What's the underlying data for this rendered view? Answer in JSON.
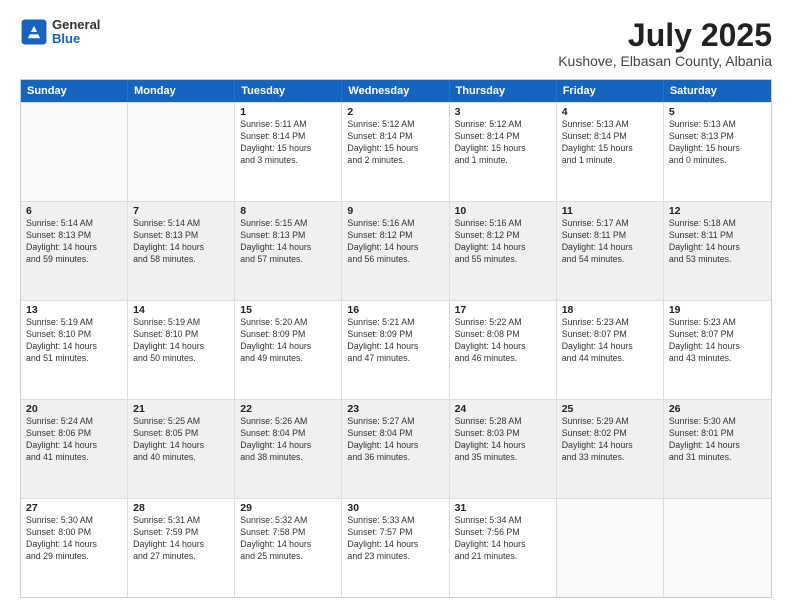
{
  "header": {
    "logo_general": "General",
    "logo_blue": "Blue",
    "main_title": "July 2025",
    "subtitle": "Kushove, Elbasan County, Albania"
  },
  "days_of_week": [
    "Sunday",
    "Monday",
    "Tuesday",
    "Wednesday",
    "Thursday",
    "Friday",
    "Saturday"
  ],
  "rows": [
    [
      {
        "day": "",
        "info": "",
        "shaded": false,
        "empty": true
      },
      {
        "day": "",
        "info": "",
        "shaded": false,
        "empty": true
      },
      {
        "day": "1",
        "info": "Sunrise: 5:11 AM\nSunset: 8:14 PM\nDaylight: 15 hours\nand 3 minutes.",
        "shaded": false,
        "empty": false
      },
      {
        "day": "2",
        "info": "Sunrise: 5:12 AM\nSunset: 8:14 PM\nDaylight: 15 hours\nand 2 minutes.",
        "shaded": false,
        "empty": false
      },
      {
        "day": "3",
        "info": "Sunrise: 5:12 AM\nSunset: 8:14 PM\nDaylight: 15 hours\nand 1 minute.",
        "shaded": false,
        "empty": false
      },
      {
        "day": "4",
        "info": "Sunrise: 5:13 AM\nSunset: 8:14 PM\nDaylight: 15 hours\nand 1 minute.",
        "shaded": false,
        "empty": false
      },
      {
        "day": "5",
        "info": "Sunrise: 5:13 AM\nSunset: 8:13 PM\nDaylight: 15 hours\nand 0 minutes.",
        "shaded": false,
        "empty": false
      }
    ],
    [
      {
        "day": "6",
        "info": "Sunrise: 5:14 AM\nSunset: 8:13 PM\nDaylight: 14 hours\nand 59 minutes.",
        "shaded": true,
        "empty": false
      },
      {
        "day": "7",
        "info": "Sunrise: 5:14 AM\nSunset: 8:13 PM\nDaylight: 14 hours\nand 58 minutes.",
        "shaded": true,
        "empty": false
      },
      {
        "day": "8",
        "info": "Sunrise: 5:15 AM\nSunset: 8:13 PM\nDaylight: 14 hours\nand 57 minutes.",
        "shaded": true,
        "empty": false
      },
      {
        "day": "9",
        "info": "Sunrise: 5:16 AM\nSunset: 8:12 PM\nDaylight: 14 hours\nand 56 minutes.",
        "shaded": true,
        "empty": false
      },
      {
        "day": "10",
        "info": "Sunrise: 5:16 AM\nSunset: 8:12 PM\nDaylight: 14 hours\nand 55 minutes.",
        "shaded": true,
        "empty": false
      },
      {
        "day": "11",
        "info": "Sunrise: 5:17 AM\nSunset: 8:11 PM\nDaylight: 14 hours\nand 54 minutes.",
        "shaded": true,
        "empty": false
      },
      {
        "day": "12",
        "info": "Sunrise: 5:18 AM\nSunset: 8:11 PM\nDaylight: 14 hours\nand 53 minutes.",
        "shaded": true,
        "empty": false
      }
    ],
    [
      {
        "day": "13",
        "info": "Sunrise: 5:19 AM\nSunset: 8:10 PM\nDaylight: 14 hours\nand 51 minutes.",
        "shaded": false,
        "empty": false
      },
      {
        "day": "14",
        "info": "Sunrise: 5:19 AM\nSunset: 8:10 PM\nDaylight: 14 hours\nand 50 minutes.",
        "shaded": false,
        "empty": false
      },
      {
        "day": "15",
        "info": "Sunrise: 5:20 AM\nSunset: 8:09 PM\nDaylight: 14 hours\nand 49 minutes.",
        "shaded": false,
        "empty": false
      },
      {
        "day": "16",
        "info": "Sunrise: 5:21 AM\nSunset: 8:09 PM\nDaylight: 14 hours\nand 47 minutes.",
        "shaded": false,
        "empty": false
      },
      {
        "day": "17",
        "info": "Sunrise: 5:22 AM\nSunset: 8:08 PM\nDaylight: 14 hours\nand 46 minutes.",
        "shaded": false,
        "empty": false
      },
      {
        "day": "18",
        "info": "Sunrise: 5:23 AM\nSunset: 8:07 PM\nDaylight: 14 hours\nand 44 minutes.",
        "shaded": false,
        "empty": false
      },
      {
        "day": "19",
        "info": "Sunrise: 5:23 AM\nSunset: 8:07 PM\nDaylight: 14 hours\nand 43 minutes.",
        "shaded": false,
        "empty": false
      }
    ],
    [
      {
        "day": "20",
        "info": "Sunrise: 5:24 AM\nSunset: 8:06 PM\nDaylight: 14 hours\nand 41 minutes.",
        "shaded": true,
        "empty": false
      },
      {
        "day": "21",
        "info": "Sunrise: 5:25 AM\nSunset: 8:05 PM\nDaylight: 14 hours\nand 40 minutes.",
        "shaded": true,
        "empty": false
      },
      {
        "day": "22",
        "info": "Sunrise: 5:26 AM\nSunset: 8:04 PM\nDaylight: 14 hours\nand 38 minutes.",
        "shaded": true,
        "empty": false
      },
      {
        "day": "23",
        "info": "Sunrise: 5:27 AM\nSunset: 8:04 PM\nDaylight: 14 hours\nand 36 minutes.",
        "shaded": true,
        "empty": false
      },
      {
        "day": "24",
        "info": "Sunrise: 5:28 AM\nSunset: 8:03 PM\nDaylight: 14 hours\nand 35 minutes.",
        "shaded": true,
        "empty": false
      },
      {
        "day": "25",
        "info": "Sunrise: 5:29 AM\nSunset: 8:02 PM\nDaylight: 14 hours\nand 33 minutes.",
        "shaded": true,
        "empty": false
      },
      {
        "day": "26",
        "info": "Sunrise: 5:30 AM\nSunset: 8:01 PM\nDaylight: 14 hours\nand 31 minutes.",
        "shaded": true,
        "empty": false
      }
    ],
    [
      {
        "day": "27",
        "info": "Sunrise: 5:30 AM\nSunset: 8:00 PM\nDaylight: 14 hours\nand 29 minutes.",
        "shaded": false,
        "empty": false
      },
      {
        "day": "28",
        "info": "Sunrise: 5:31 AM\nSunset: 7:59 PM\nDaylight: 14 hours\nand 27 minutes.",
        "shaded": false,
        "empty": false
      },
      {
        "day": "29",
        "info": "Sunrise: 5:32 AM\nSunset: 7:58 PM\nDaylight: 14 hours\nand 25 minutes.",
        "shaded": false,
        "empty": false
      },
      {
        "day": "30",
        "info": "Sunrise: 5:33 AM\nSunset: 7:57 PM\nDaylight: 14 hours\nand 23 minutes.",
        "shaded": false,
        "empty": false
      },
      {
        "day": "31",
        "info": "Sunrise: 5:34 AM\nSunset: 7:56 PM\nDaylight: 14 hours\nand 21 minutes.",
        "shaded": false,
        "empty": false
      },
      {
        "day": "",
        "info": "",
        "shaded": false,
        "empty": true
      },
      {
        "day": "",
        "info": "",
        "shaded": false,
        "empty": true
      }
    ]
  ]
}
